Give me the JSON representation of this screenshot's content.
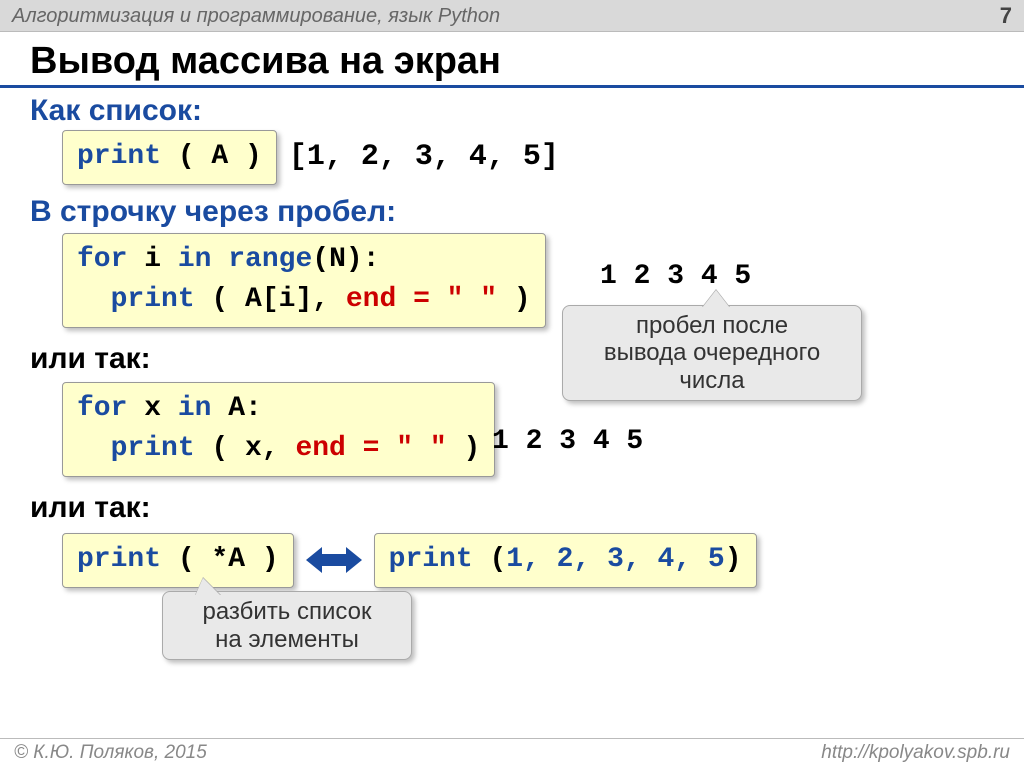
{
  "header": {
    "title": "Алгоритмизация и программирование, язык Python",
    "page": "7"
  },
  "heading": "Вывод массива на экран",
  "s1": {
    "title": "Как список:",
    "code_kw": "print",
    "code_rest": " ( A )",
    "output": "[1, 2, 3, 4, 5]"
  },
  "s2": {
    "title": "В строчку через пробел:",
    "code_l1a": "for",
    "code_l1b": " i ",
    "code_l1c": "in",
    "code_l1d": " range",
    "code_l1e": "(N):",
    "code_l2a": "  print",
    "code_l2b": " ( A[i], ",
    "code_l2c": "end = \" \"",
    "code_l2d": " )",
    "output": "1 2 3 4 5",
    "callout": "пробел после\nвывода очередного\nчисла"
  },
  "s3": {
    "title": "или так:",
    "code_l1a": "for",
    "code_l1b": " x ",
    "code_l1c": "in",
    "code_l1d": " A:",
    "code_l2a": "  print",
    "code_l2b": " ( x, ",
    "code_l2c": "end = \" \"",
    "code_l2d": " )",
    "output": "1 2 3 4 5"
  },
  "s4": {
    "title": "или так:",
    "left_kw": "print",
    "left_rest": " ( *A )",
    "right_kw": "print",
    "right_rest_a": " (",
    "right_rest_b": "1, 2, 3, 4, 5",
    "right_rest_c": ")",
    "callout": "разбить список\nна элементы"
  },
  "footer": {
    "left": "© К.Ю. Поляков, 2015",
    "right": "http://kpolyakov.spb.ru"
  }
}
